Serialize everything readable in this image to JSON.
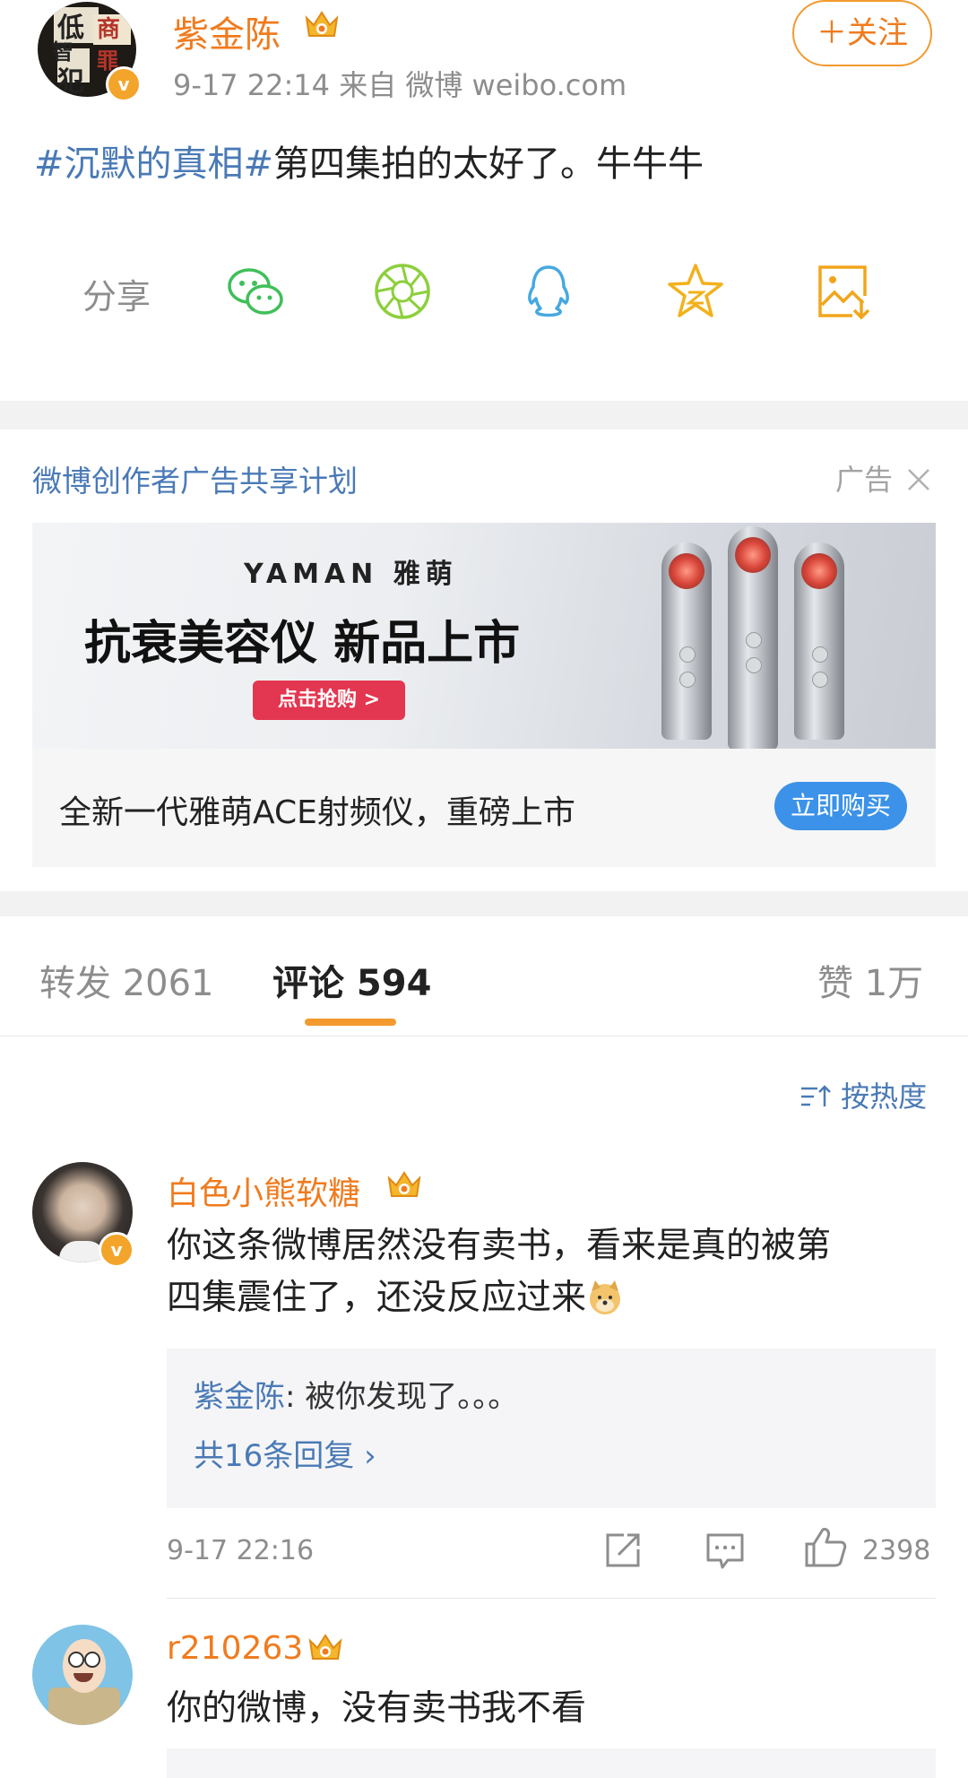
{
  "post": {
    "username": "紫金陈",
    "meta": "9-17 22:14   来自 微博 weibo.com",
    "follow_label": "＋关注",
    "topic": "#沉默的真相#",
    "text": "第四集拍的太好了。牛牛牛",
    "avatar_text": [
      "低",
      "商",
      "智",
      "犯",
      "罪"
    ],
    "verified_mark": "v"
  },
  "share": {
    "label": "分享",
    "icons": [
      "wechat-icon",
      "moments-icon",
      "qq-icon",
      "qzone-icon",
      "save-image-icon"
    ]
  },
  "ad": {
    "title": "微博创作者广告共享计划",
    "tag": "广告",
    "brand": "YAMAN 雅萌",
    "headline": "抗衰美容仪  新品上市",
    "banner_button": "点击抢购 >",
    "description": "全新一代雅萌ACE射频仪，重磅上市",
    "buy_label": "立即购买"
  },
  "tabs": [
    {
      "label": "转发 2061"
    },
    {
      "label": "评论 594"
    },
    {
      "label": "赞 1万"
    }
  ],
  "sort_label": "按热度",
  "comments": [
    {
      "name": "白色小熊软糖",
      "text_line1": "你这条微博居然没有卖书，看来是真的被第",
      "text_line2": "四集震住了，还没反应过来",
      "reply_author": "紫金陈",
      "reply_text": ": 被你发现了。。。",
      "reply_more": "共16条回复 ›",
      "time": "9-17 22:16",
      "likes": "2398"
    },
    {
      "name": "r210263",
      "text_line1": "你的微博，没有卖书我不看"
    }
  ],
  "colors": {
    "accent_orange": "#f07b1e",
    "link_blue": "#4a7ab6",
    "buy_blue": "#3b92e8"
  }
}
